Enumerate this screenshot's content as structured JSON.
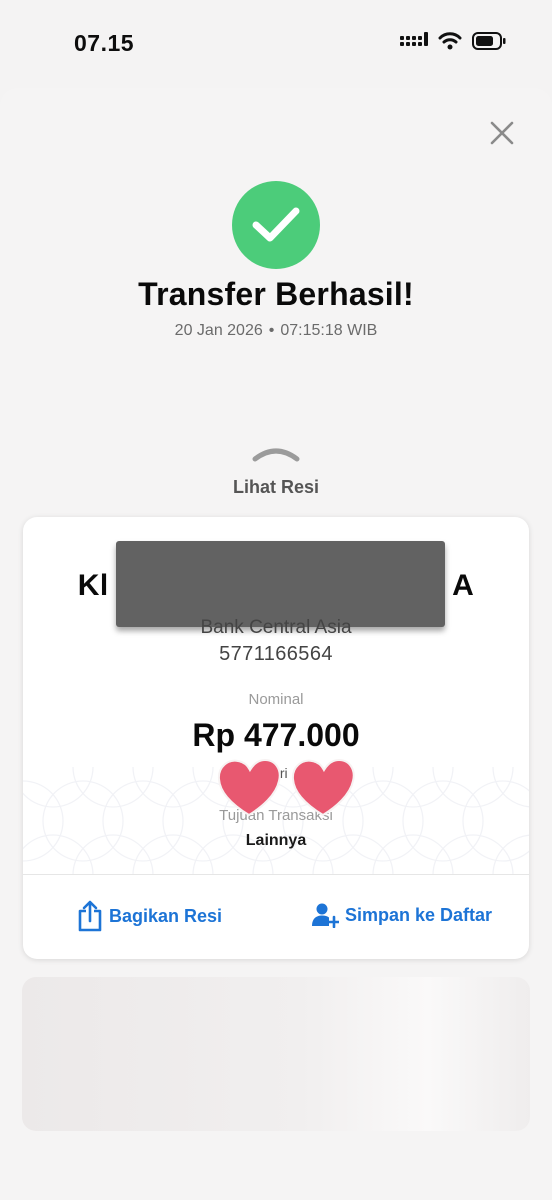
{
  "status_bar": {
    "time": "07.15",
    "icons": [
      "signal-icon",
      "wifi-icon",
      "battery-icon"
    ]
  },
  "header": {
    "close_icon": "close-icon"
  },
  "result": {
    "icon": "checkmark-icon",
    "title": "Transfer Berhasil!",
    "date": "20 Jan 2026",
    "separator": "•",
    "time": "07:15:18 WIB"
  },
  "receipt_toggle": {
    "icon": "chevron-up-icon",
    "label": "Lihat Resi"
  },
  "receipt": {
    "recipient_name_visible": "Kl                                       A",
    "bank_name": "Bank Central Asia",
    "account_number": "5771166564",
    "nominal_label": "Nominal",
    "amount": "Rp 477.000",
    "sender_prefix": "dari",
    "purpose_label": "Tujuan Transaksi",
    "purpose_value": "Lainnya"
  },
  "actions": {
    "share_label": "Bagikan Resi",
    "share_icon": "share-icon",
    "save_label": "Simpan ke Daftar",
    "save_icon": "add-user-icon"
  },
  "colors": {
    "success": "#4ccc7a",
    "accent": "#1d74d6",
    "heart": "#e85870",
    "redaction": "#626262"
  }
}
